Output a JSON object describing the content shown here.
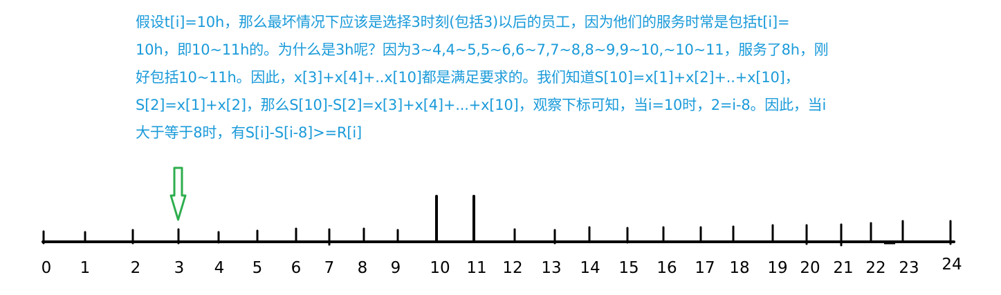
{
  "colors": {
    "note_text": "#1a9ad9",
    "arrow": "#2eae4e",
    "axis": "#000000"
  },
  "note_lines": [
    "假设t[i]=10h，那么最坏情况下应该是选择3时刻(包括3)以后的员工，因为他们的服务时常是包括t[i]=",
    "10h，即10~11h的。为什么是3h呢？因为3~4,4~5,5~6,6~7,7~8,8~9,9~10,~10~11，服务了8h，刚",
    "好包括10~11h。因此，x[3]+x[4]+..x[10]都是满足要求的。我们知道S[10]=x[1]+x[2]+..+x[10]，",
    "S[2]=x[1]+x[2]，那么S[10]-S[2]=x[3]+x[4]+...+x[10]，观察下标可知，当i=10时，2=i-8。因此，当i",
    "大于等于8时，有S[i]-S[i-8]>=R[i]"
  ],
  "timeline": {
    "ticks": [
      "0",
      "1",
      "2",
      "3",
      "4",
      "5",
      "6",
      "7",
      "8",
      "9",
      "10",
      "11",
      "12",
      "13",
      "14",
      "15",
      "16",
      "17",
      "18",
      "19",
      "20",
      "21",
      "22",
      "23",
      "24"
    ],
    "highlighted_ticks": [
      "10",
      "11"
    ],
    "arrow_tick": "3",
    "arrow_icon": "hollow-down-arrow-icon"
  }
}
